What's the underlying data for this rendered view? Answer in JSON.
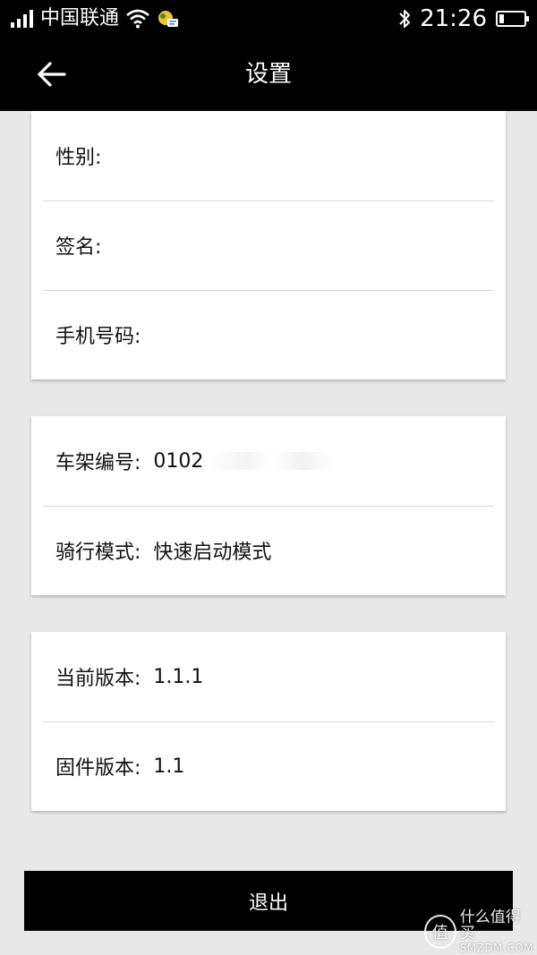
{
  "status_bar": {
    "carrier": "中国联通",
    "time": "21:26",
    "battery_level": 0.2,
    "icons": [
      "signal-icon",
      "wifi-icon",
      "notification-app-icon",
      "bluetooth-icon",
      "battery-icon"
    ]
  },
  "toolbar": {
    "title": "设置",
    "back_icon": "arrow-left-icon"
  },
  "profile_card": {
    "gender_label": "性别:",
    "signature_label": "签名:",
    "phone_label": "手机号码:"
  },
  "bike_card": {
    "frame_label": "车架编号:",
    "frame_value": "0102",
    "mode_label": "骑行模式:",
    "mode_value": "快速启动模式"
  },
  "version_card": {
    "app_version_label": "当前版本:",
    "app_version_value": "1.1.1",
    "firmware_label": "固件版本:",
    "firmware_value": "1.1"
  },
  "logout_label": "退出",
  "watermark": {
    "icon_char": "值",
    "text_cn": "什么值得买",
    "text_en": "SMZDM.COM"
  },
  "colors": {
    "bar_background": "#000000",
    "page_background": "#e8e8e8",
    "card_background": "#ffffff",
    "divider": "#d9d9d9"
  }
}
